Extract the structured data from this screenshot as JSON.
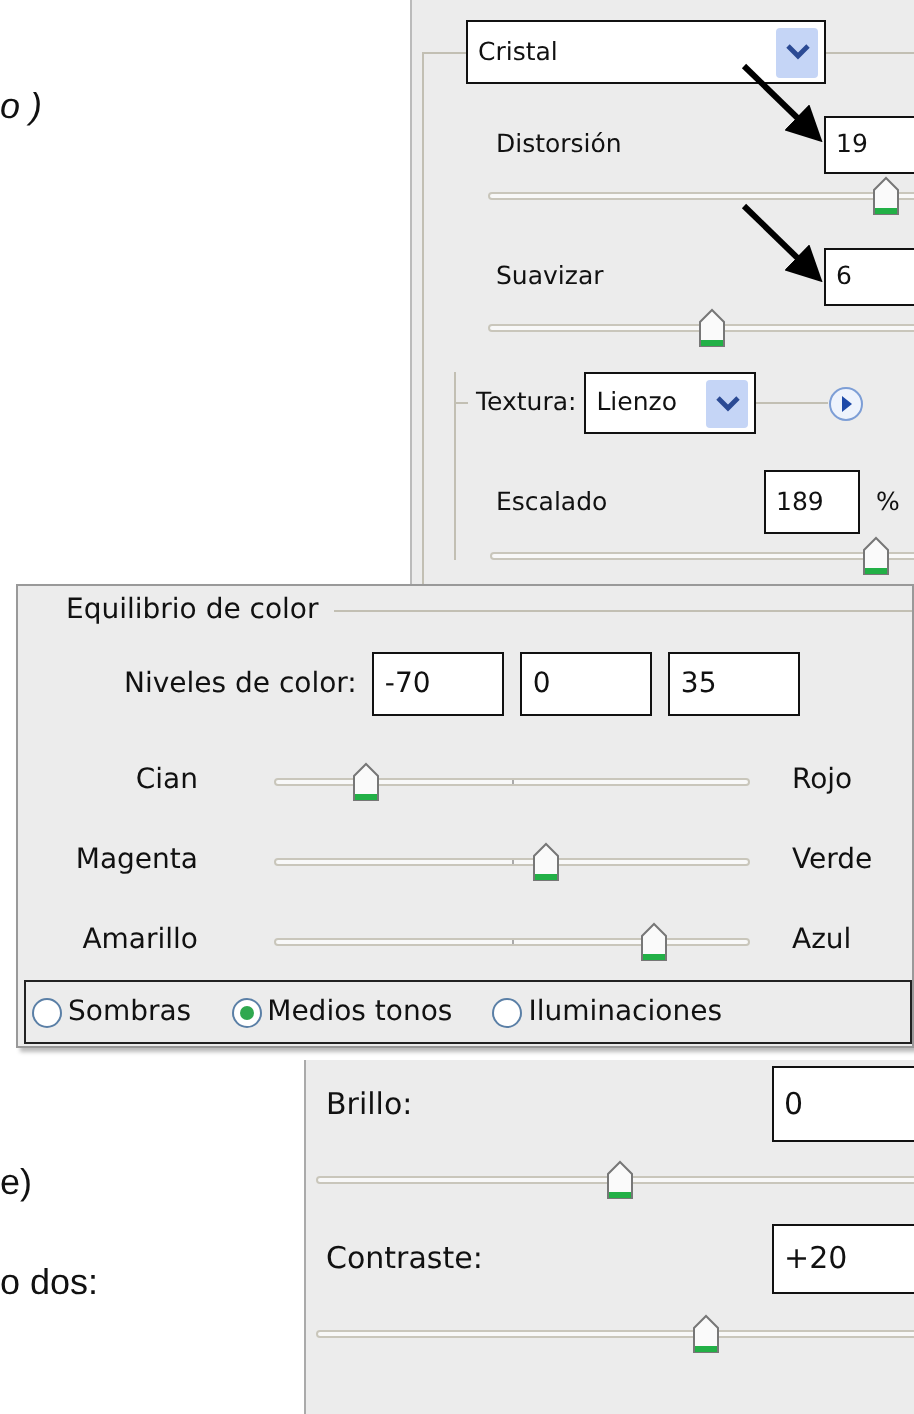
{
  "document_fragments": [
    {
      "text": "o )",
      "italic": true
    },
    {
      "text": "e)",
      "italic": false
    },
    {
      "text": "o dos:",
      "italic": false
    }
  ],
  "distort_panel": {
    "dropdown": "Cristal",
    "params": [
      {
        "label": "Distorsión",
        "value": "19",
        "level": 0.93
      },
      {
        "label": "Suavizar",
        "value": "6",
        "level": 0.52
      }
    ],
    "texture": {
      "label": "Textura:",
      "dropdown": "Lienzo",
      "scaling": {
        "label": "Escalado",
        "value": "189",
        "unit": "%",
        "level": 0.9
      }
    }
  },
  "color_balance": {
    "title": "Equilibrio de color",
    "levels_label": "Niveles de color:",
    "levels": [
      "-70",
      "0",
      "35"
    ],
    "sliders": [
      {
        "left": "Cian",
        "right": "Rojo",
        "level": 0.19
      },
      {
        "left": "Magenta",
        "right": "Verde",
        "level": 0.57
      },
      {
        "left": "Amarillo",
        "right": "Azul",
        "level": 0.8
      }
    ],
    "tones": [
      {
        "label": "Sombras",
        "selected": false
      },
      {
        "label": "Medios tonos",
        "selected": true
      },
      {
        "label": "Iluminaciones",
        "selected": false
      }
    ]
  },
  "brightness_contrast": [
    {
      "label": "Brillo:",
      "value": "0",
      "level": 0.49
    },
    {
      "label": "Contraste:",
      "value": "+20",
      "level": 0.63
    }
  ]
}
